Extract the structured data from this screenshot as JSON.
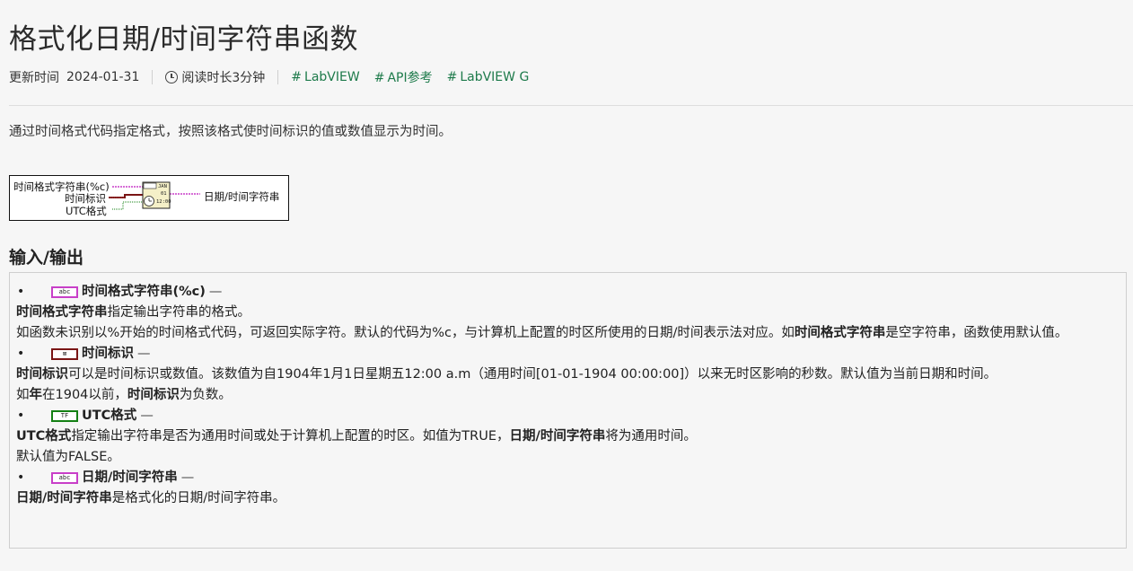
{
  "page": {
    "title": "格式化日期/时间字符串函数",
    "updated_label": "更新时间",
    "updated_date": "2024-01-31",
    "read_time": "阅读时长3分钟",
    "tags": [
      "LabVIEW",
      "API参考",
      "LabVIEW G"
    ],
    "description": "通过时间格式代码指定格式，按照该格式使时间标识的值或数值显示为时间。"
  },
  "diagram": {
    "inputs": [
      "时间格式字符串(%c)",
      "时间标识",
      "UTC格式"
    ],
    "output": "日期/时间字符串",
    "icon_text": [
      "JAN",
      "01",
      "12:00"
    ]
  },
  "io": {
    "heading": "输入/输出",
    "items": [
      {
        "name": "时间格式字符串(%c)",
        "term": "abc",
        "dash": "—",
        "p1_bold": "时间格式字符串",
        "p1_rest": "指定输出字符串的格式。",
        "p2_a": "如函数未识别以%开始的时间格式代码，可返回实际字符。默认的代码为%c，与计算机上配置的时区所使用的日期/时间表示法对应。如",
        "p2_bold": "时间格式字符串",
        "p2_b": "是空字符串，函数使用默认值。"
      },
      {
        "name": "时间标识",
        "term": "⊠",
        "dash": "—",
        "p1_bold": "时间标识",
        "p1_rest": "可以是时间标识或数值。该数值为自1904年1月1日星期五12:00 a.m（通用时间[01-01-1904 00:00:00]）以来无时区影响的秒数。默认值为当前日期和时间。",
        "p2_a": "如",
        "p2_bold1": "年",
        "p2_b": "在1904以前，",
        "p2_bold2": "时间标识",
        "p2_c": "为负数。"
      },
      {
        "name": "UTC格式",
        "term": "TF",
        "dash": "—",
        "p1_bold": "UTC格式",
        "p1_rest": "指定输出字符串是否为通用时间或处于计算机上配置的时区。如值为TRUE，",
        "p1_bold2": "日期/时间字符串",
        "p1_rest2": "将为通用时间。",
        "p2": "默认值为FALSE。"
      },
      {
        "name": "日期/时间字符串",
        "term": "abc",
        "dash": "—",
        "p1_bold": "日期/时间字符串",
        "p1_rest": "是格式化的日期/时间字符串。"
      }
    ]
  },
  "colors": {
    "tag": "#1d7a4a",
    "string_wire": "#c83fc8",
    "timestamp_wire": "#7a1515",
    "boolean_wire": "#148014"
  }
}
